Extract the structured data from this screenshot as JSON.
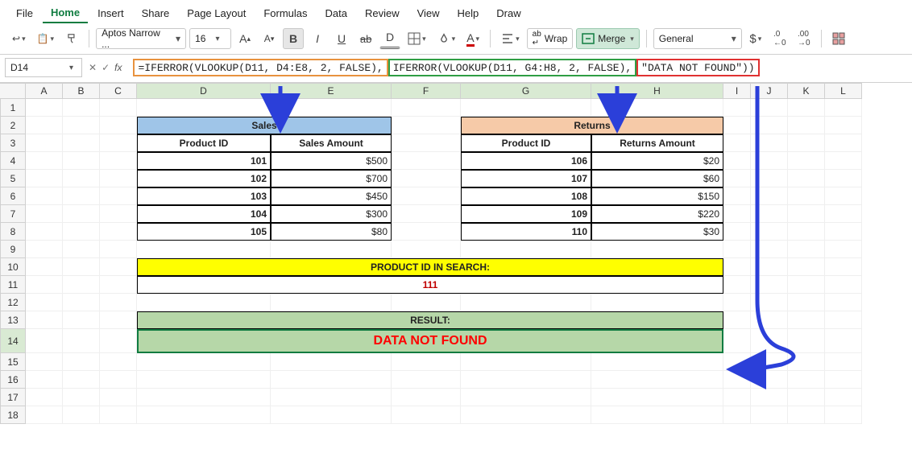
{
  "ribbon_tabs": {
    "file": "File",
    "home": "Home",
    "insert": "Insert",
    "share": "Share",
    "page_layout": "Page Layout",
    "formulas": "Formulas",
    "data": "Data",
    "review": "Review",
    "view": "View",
    "help": "Help",
    "draw": "Draw"
  },
  "toolbar": {
    "font_name": "Aptos Narrow ...",
    "font_size": "16",
    "wrap_label": "Wrap",
    "merge_label": "Merge",
    "numfmt": "General"
  },
  "namebox": "D14",
  "formula": {
    "part1": "=IFERROR(VLOOKUP(D11, D4:E8, 2, FALSE),",
    "part2": "IFERROR(VLOOKUP(D11, G4:H8, 2, FALSE),",
    "part3": "\"DATA NOT FOUND\"))"
  },
  "columns": [
    "A",
    "B",
    "C",
    "D",
    "E",
    "F",
    "G",
    "H",
    "I",
    "J",
    "K",
    "L"
  ],
  "rows": [
    "1",
    "2",
    "3",
    "4",
    "5",
    "6",
    "7",
    "8",
    "9",
    "10",
    "11",
    "12",
    "13",
    "14",
    "15",
    "16",
    "17",
    "18"
  ],
  "sales": {
    "title": "Sales",
    "id_hdr": "Product ID",
    "amt_hdr": "Sales Amount",
    "rows": [
      {
        "id": "101",
        "amt": "$500"
      },
      {
        "id": "102",
        "amt": "$700"
      },
      {
        "id": "103",
        "amt": "$450"
      },
      {
        "id": "104",
        "amt": "$300"
      },
      {
        "id": "105",
        "amt": "$80"
      }
    ]
  },
  "returns": {
    "title": "Returns",
    "id_hdr": "Product ID",
    "amt_hdr": "Returns Amount",
    "rows": [
      {
        "id": "106",
        "amt": "$20"
      },
      {
        "id": "107",
        "amt": "$60"
      },
      {
        "id": "108",
        "amt": "$150"
      },
      {
        "id": "109",
        "amt": "$220"
      },
      {
        "id": "110",
        "amt": "$30"
      }
    ]
  },
  "search": {
    "label": "PRODUCT ID IN SEARCH:",
    "value": "111"
  },
  "result": {
    "label": "RESULT:",
    "value": "DATA NOT FOUND"
  }
}
